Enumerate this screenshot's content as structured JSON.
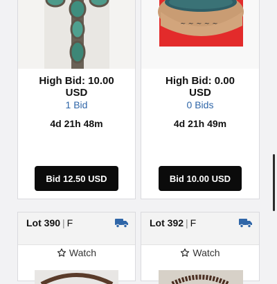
{
  "lots": [
    {
      "high_bid": "High Bid: 10.00",
      "currency": "USD",
      "bid_count": "1 Bid",
      "time_left": "4d 21h 48m",
      "bid_button": "Bid 12.50 USD"
    },
    {
      "high_bid": "High Bid: 0.00",
      "currency": "USD",
      "bid_count": "0 Bids",
      "time_left": "4d 21h 49m",
      "bid_button": "Bid 10.00 USD"
    },
    {
      "lot_label": "Lot",
      "lot_number": "390",
      "lot_tag": "F",
      "watch_label": "Watch"
    },
    {
      "lot_label": "Lot",
      "lot_number": "392",
      "lot_tag": "F",
      "watch_label": "Watch"
    }
  ],
  "icons": {
    "shipping": "truck-icon",
    "watch": "star-icon"
  },
  "colors": {
    "button": "#0b0b0b",
    "bid_count": "#2f66a8",
    "shipping_icon": "#2f66a8"
  }
}
